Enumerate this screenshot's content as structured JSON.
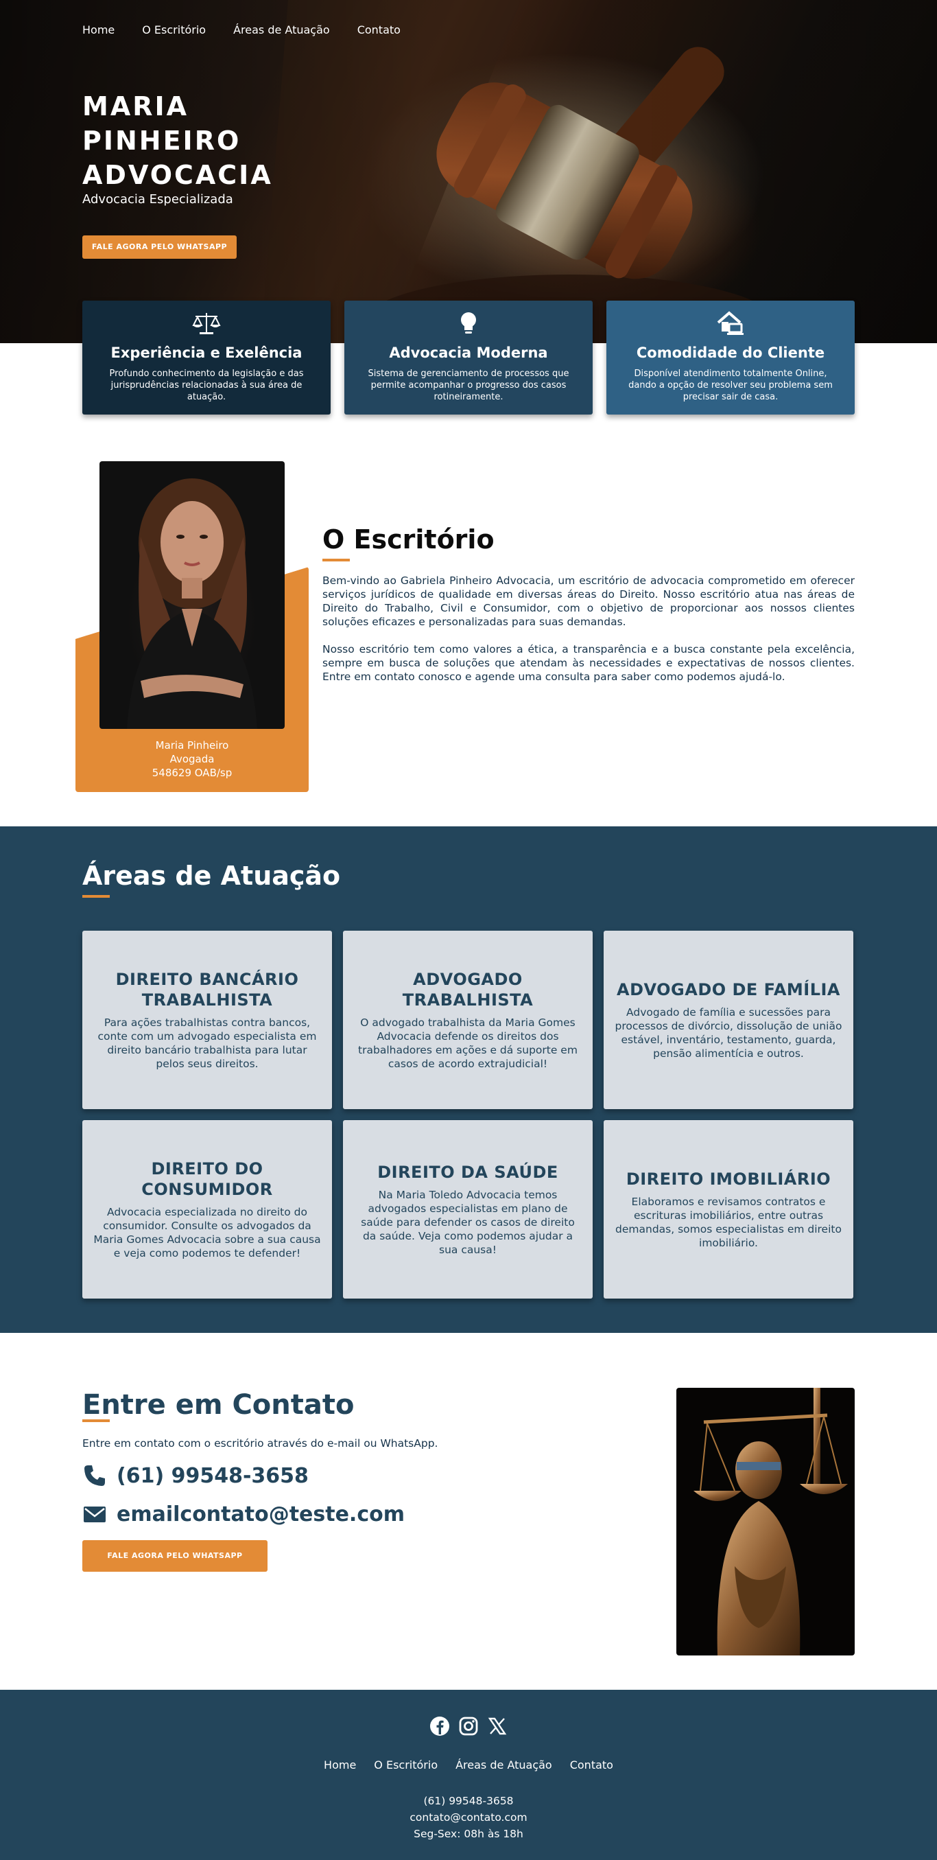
{
  "nav": {
    "items": [
      "Home",
      "O Escritório",
      "Áreas de Atuação",
      "Contato"
    ]
  },
  "hero": {
    "title": "MARIA PINHEIRO ADVOCACIA",
    "subtitle": "Advocacia Especializada",
    "cta_label": "FALE AGORA PELO WHATSAPP"
  },
  "features": [
    {
      "icon": "scale-icon",
      "title": "Experiência e Exelência",
      "text": "Profundo conhecimento da legislação e das jurisprudências relacionadas à sua área de atuação."
    },
    {
      "icon": "lightbulb-icon",
      "title": "Advocacia Moderna",
      "text": "Sistema de gerenciamento de processos que permite acompanhar o progresso dos casos rotineiramente."
    },
    {
      "icon": "house-laptop-icon",
      "title": "Comodidade do Cliente",
      "text": "Disponível atendimento totalmente Online, dando a opção de resolver seu problema sem precisar sair de casa."
    }
  ],
  "office": {
    "title": "O Escritório",
    "caption_name": "Maria Pinheiro",
    "caption_role": "Avogada",
    "caption_oab": "548629 OAB/sp",
    "paragraph_1": "Bem-vindo ao Gabriela Pinheiro Advocacia, um escritório de advocacia comprometido em oferecer serviços jurídicos de qualidade em diversas áreas do Direito. Nosso escritório atua nas áreas de Direito do Trabalho, Civil e Consumidor, com o objetivo de proporcionar aos nossos clientes soluções eficazes e personalizadas para suas demandas.",
    "paragraph_2": "Nosso escritório tem como valores a ética, a transparência e a busca constante pela excelência, sempre em busca de soluções que atendam às necessidades e expectativas de nossos clientes. Entre em contato conosco e agende uma consulta para saber como podemos ajudá-lo."
  },
  "areas": {
    "title": "Áreas de Atuação",
    "items": [
      {
        "title": "DIREITO BANCÁRIO TRABALHISTA",
        "text": "Para ações trabalhistas contra bancos, conte com um advogado especialista em direito bancário trabalhista para lutar pelos seus direitos."
      },
      {
        "title": "ADVOGADO TRABALHISTA",
        "text": "O advogado trabalhista da Maria Gomes Advocacia defende os direitos dos trabalhadores em ações e dá suporte em casos de acordo extrajudicial!"
      },
      {
        "title": "ADVOGADO DE FAMÍLIA",
        "text": "Advogado de família e sucessões para processos de divórcio, dissolução de união estável, inventário, testamento, guarda, pensão alimentícia e outros."
      },
      {
        "title": "DIREITO DO CONSUMIDOR",
        "text": "Advocacia especializada no direito do consumidor. Consulte os advogados da Maria Gomes Advocacia sobre a sua causa e veja como podemos te defender!"
      },
      {
        "title": "DIREITO DA SAÚDE",
        "text": "Na Maria Toledo Advocacia temos advogados especialistas em plano de saúde para defender os casos de direito da saúde. Veja como podemos ajudar a sua causa!"
      },
      {
        "title": "DIREITO IMOBILIÁRIO",
        "text": "Elaboramos e revisamos contratos e escrituras imobiliários, entre outras demandas, somos especialistas em direito imobiliário."
      }
    ]
  },
  "contact": {
    "title": "Entre em Contato",
    "intro": "Entre em contato com o escritório através do e-mail ou WhatsApp.",
    "phone": "(61) 99548-3658",
    "email": "emailcontato@teste.com",
    "cta_label": "FALE AGORA PELO WHATSAPP"
  },
  "footer": {
    "social_icons": [
      "facebook-icon",
      "instagram-icon",
      "x-icon"
    ],
    "nav": [
      "Home",
      "O Escritório",
      "Áreas de Atuação",
      "Contato"
    ],
    "phone": "(61) 99548-3658",
    "email": "contato@contato.com",
    "hours": "Seg-Sex: 08h às 18h"
  },
  "colors": {
    "navy": "#23455b",
    "dark_navy": "#122a3b",
    "blue": "#2f6185",
    "orange": "#e38b36",
    "card_gray": "#d8dde3"
  }
}
